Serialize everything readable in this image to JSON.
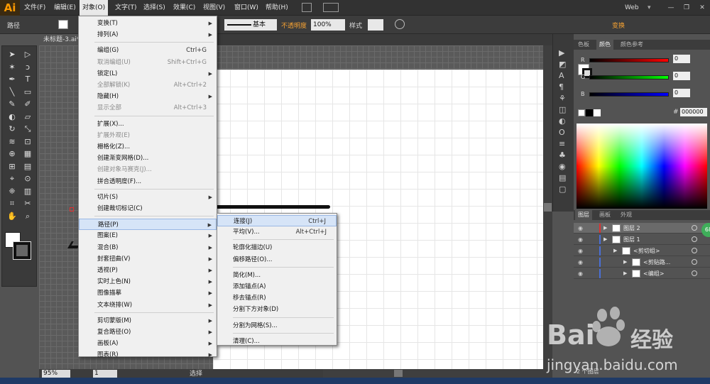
{
  "app": {
    "logo": "Ai",
    "workspace": "Web",
    "user_badge": "68"
  },
  "menubar": [
    "文件(F)",
    "编辑(E)",
    "对象(O)",
    "文字(T)",
    "选择(S)",
    "效果(C)",
    "视图(V)",
    "窗口(W)",
    "帮助(H)"
  ],
  "control": {
    "selection_label": "路径",
    "stroke_profile": "基本",
    "opacity_label": "不透明度",
    "opacity_value": "100%",
    "style_label": "样式",
    "transform_label": "变换"
  },
  "document_tab": "未标题-3.ai*",
  "object_menu": [
    {
      "label": "变换(T)",
      "shortcut": "",
      "submenu": true,
      "disabled": false
    },
    {
      "label": "排列(A)",
      "shortcut": "",
      "submenu": true,
      "disabled": false
    },
    {
      "sep": true
    },
    {
      "label": "编组(G)",
      "shortcut": "Ctrl+G",
      "submenu": false,
      "disabled": false
    },
    {
      "label": "取消编组(U)",
      "shortcut": "Shift+Ctrl+G",
      "submenu": false,
      "disabled": true
    },
    {
      "label": "锁定(L)",
      "shortcut": "",
      "submenu": true,
      "disabled": false
    },
    {
      "label": "全部解锁(K)",
      "shortcut": "Alt+Ctrl+2",
      "submenu": false,
      "disabled": true
    },
    {
      "label": "隐藏(H)",
      "shortcut": "",
      "submenu": true,
      "disabled": false
    },
    {
      "label": "显示全部",
      "shortcut": "Alt+Ctrl+3",
      "submenu": false,
      "disabled": true
    },
    {
      "sep": true
    },
    {
      "label": "扩展(X)...",
      "shortcut": "",
      "submenu": false,
      "disabled": false
    },
    {
      "label": "扩展外观(E)",
      "shortcut": "",
      "submenu": false,
      "disabled": true
    },
    {
      "label": "栅格化(Z)...",
      "shortcut": "",
      "submenu": false,
      "disabled": false
    },
    {
      "label": "创建渐变网格(D)...",
      "shortcut": "",
      "submenu": false,
      "disabled": false
    },
    {
      "label": "创建对象马赛克(J)...",
      "shortcut": "",
      "submenu": false,
      "disabled": true
    },
    {
      "label": "拼合透明度(F)...",
      "shortcut": "",
      "submenu": false,
      "disabled": false
    },
    {
      "sep": true
    },
    {
      "label": "切片(S)",
      "shortcut": "",
      "submenu": true,
      "disabled": false
    },
    {
      "label": "创建裁切标记(C)",
      "shortcut": "",
      "submenu": false,
      "disabled": false
    },
    {
      "sep": true
    },
    {
      "label": "路径(P)",
      "shortcut": "",
      "submenu": true,
      "disabled": false,
      "highlighted": true
    },
    {
      "label": "图案(E)",
      "shortcut": "",
      "submenu": true,
      "disabled": false
    },
    {
      "label": "混合(B)",
      "shortcut": "",
      "submenu": true,
      "disabled": false
    },
    {
      "label": "封套扭曲(V)",
      "shortcut": "",
      "submenu": true,
      "disabled": false
    },
    {
      "label": "透视(P)",
      "shortcut": "",
      "submenu": true,
      "disabled": false
    },
    {
      "label": "实时上色(N)",
      "shortcut": "",
      "submenu": true,
      "disabled": false
    },
    {
      "label": "图像描摹",
      "shortcut": "",
      "submenu": true,
      "disabled": false
    },
    {
      "label": "文本绕排(W)",
      "shortcut": "",
      "submenu": true,
      "disabled": false
    },
    {
      "sep": true
    },
    {
      "label": "剪切蒙版(M)",
      "shortcut": "",
      "submenu": true,
      "disabled": false
    },
    {
      "label": "复合路径(O)",
      "shortcut": "",
      "submenu": true,
      "disabled": false
    },
    {
      "label": "画板(A)",
      "shortcut": "",
      "submenu": true,
      "disabled": false
    },
    {
      "label": "图表(R)",
      "shortcut": "",
      "submenu": true,
      "disabled": false
    }
  ],
  "path_submenu": [
    {
      "label": "连接(J)",
      "shortcut": "Ctrl+J",
      "highlighted": true
    },
    {
      "label": "平均(V)...",
      "shortcut": "Alt+Ctrl+J"
    },
    {
      "sep": true
    },
    {
      "label": "轮廓化描边(U)",
      "shortcut": ""
    },
    {
      "label": "偏移路径(O)...",
      "shortcut": ""
    },
    {
      "sep": true
    },
    {
      "label": "简化(M)...",
      "shortcut": ""
    },
    {
      "label": "添加锚点(A)",
      "shortcut": ""
    },
    {
      "label": "移去锚点(R)",
      "shortcut": ""
    },
    {
      "label": "分割下方对象(D)",
      "shortcut": ""
    },
    {
      "sep": true
    },
    {
      "label": "分割为网格(S)...",
      "shortcut": ""
    },
    {
      "sep": true
    },
    {
      "label": "清理(C)...",
      "shortcut": ""
    }
  ],
  "color_panel": {
    "tabs": [
      "色板",
      "颜色",
      "颜色参考"
    ],
    "r": "0",
    "g": "0",
    "b": "0",
    "hex": "000000"
  },
  "layers_panel": {
    "tabs": [
      "图层",
      "画板",
      "外观"
    ],
    "rows": [
      {
        "label": "图层 2",
        "indent": 0
      },
      {
        "label": "图层 1",
        "indent": 0
      },
      {
        "label": "<剪切组>",
        "indent": 1
      },
      {
        "label": "<剪贴路...",
        "indent": 2
      },
      {
        "label": "<编组>",
        "indent": 2
      }
    ],
    "footer": "2 个图层"
  },
  "status": {
    "zoom": "95%",
    "artboard": "1",
    "tool": "选择"
  },
  "watermark": {
    "brand": "Bai",
    "brand2": "经验",
    "url": "jingyan.baidu.com"
  }
}
